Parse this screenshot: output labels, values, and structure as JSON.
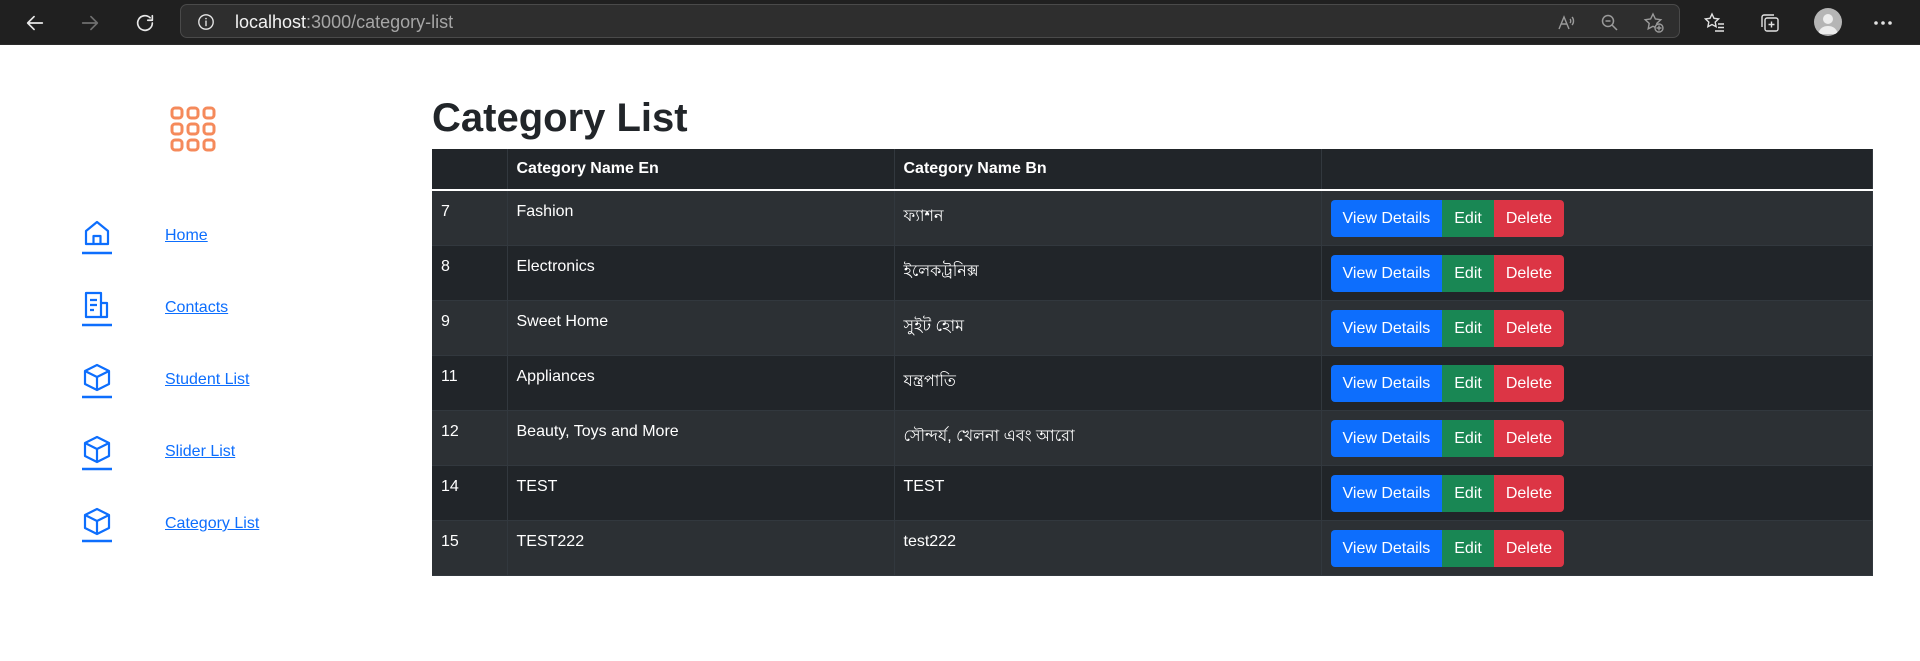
{
  "browser": {
    "url_host": "localhost",
    "url_path": ":3000/category-list"
  },
  "sidebar": {
    "items": [
      {
        "label": "Home",
        "icon": "home-icon"
      },
      {
        "label": "Contacts",
        "icon": "contacts-icon"
      },
      {
        "label": "Student List",
        "icon": "cube-icon"
      },
      {
        "label": "Slider List",
        "icon": "cube-icon"
      },
      {
        "label": "Category List",
        "icon": "cube-icon"
      }
    ]
  },
  "main": {
    "title": "Category List",
    "table": {
      "headers": [
        "",
        "Category Name En",
        "Category Name Bn",
        ""
      ],
      "rows": [
        {
          "id": "7",
          "name_en": "Fashion",
          "name_bn": "ফ্যাশন"
        },
        {
          "id": "8",
          "name_en": "Electronics",
          "name_bn": "ইলেকট্রনিক্স"
        },
        {
          "id": "9",
          "name_en": "Sweet Home",
          "name_bn": "সুইট হোম"
        },
        {
          "id": "11",
          "name_en": "Appliances",
          "name_bn": "যন্ত্রপাতি"
        },
        {
          "id": "12",
          "name_en": "Beauty, Toys and More",
          "name_bn": "সৌন্দর্য, খেলনা এবং আরো"
        },
        {
          "id": "14",
          "name_en": "TEST",
          "name_bn": "TEST"
        },
        {
          "id": "15",
          "name_en": "TEST222",
          "name_bn": "test222"
        }
      ],
      "actions": {
        "view": "View Details",
        "edit": "Edit",
        "delete": "Delete"
      }
    }
  },
  "colors": {
    "primary": "#0d6efd",
    "success": "#198754",
    "danger": "#dc3545",
    "table_dark": "#212529",
    "table_stripe": "#2c3034",
    "logo": "#f58a5b"
  }
}
